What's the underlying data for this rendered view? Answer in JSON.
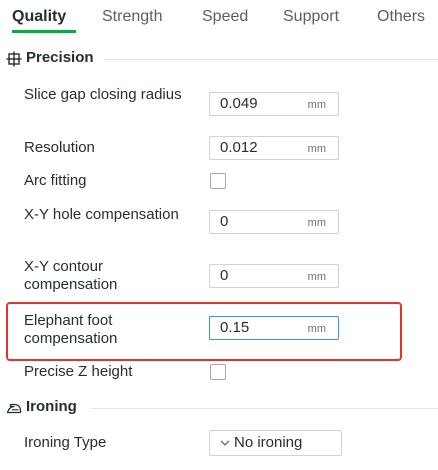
{
  "tabs": [
    {
      "label": "Quality",
      "active": true
    },
    {
      "label": "Strength",
      "active": false
    },
    {
      "label": "Speed",
      "active": false
    },
    {
      "label": "Support",
      "active": false
    },
    {
      "label": "Others",
      "active": false
    }
  ],
  "sections": {
    "precision": {
      "title": "Precision",
      "icon": "precision-crosshair-icon"
    },
    "ironing": {
      "title": "Ironing",
      "icon": "iron-icon"
    }
  },
  "rows": {
    "slice_gap": {
      "label": "Slice gap closing radius",
      "value": "0.049",
      "unit": "mm"
    },
    "resolution": {
      "label": "Resolution",
      "value": "0.012",
      "unit": "mm"
    },
    "arc_fitting": {
      "label": "Arc fitting",
      "checked": false
    },
    "xy_hole": {
      "label": "X-Y hole compensation",
      "value": "0",
      "unit": "mm"
    },
    "xy_contour": {
      "label": "X-Y contour compensation",
      "value": "0",
      "unit": "mm"
    },
    "elephant_foot": {
      "label": "Elephant foot compensation",
      "value": "0.15",
      "unit": "mm"
    },
    "precise_z": {
      "label": "Precise Z height",
      "checked": false
    },
    "ironing_type": {
      "label": "Ironing Type",
      "value": "No ironing"
    }
  },
  "colors": {
    "accent": "#00ae42",
    "highlight": "#e5332a",
    "focus": "#3a8ee6"
  }
}
